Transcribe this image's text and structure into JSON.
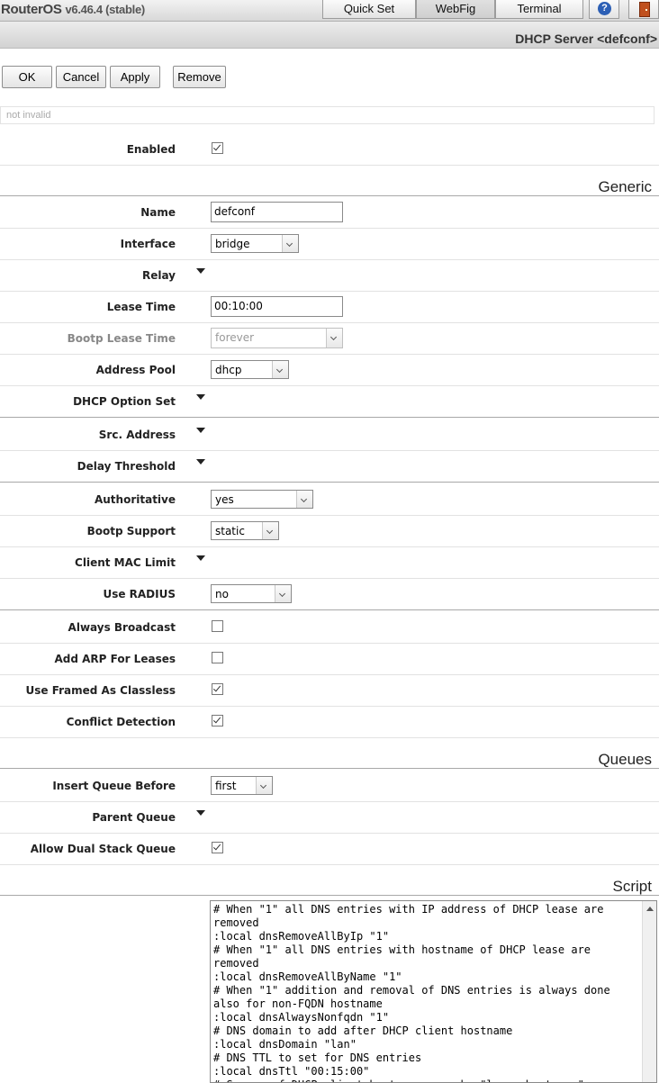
{
  "topbar": {
    "brand": "RouterOS",
    "version": "v6.46.4 (stable)",
    "tabs": [
      {
        "label": "Quick Set",
        "active": false
      },
      {
        "label": "WebFig",
        "active": true
      },
      {
        "label": "Terminal",
        "active": false
      }
    ],
    "help_icon": "question-icon",
    "logout_icon": "door-icon"
  },
  "title": "DHCP Server <defconf>",
  "actions": {
    "ok": "OK",
    "cancel": "Cancel",
    "apply": "Apply",
    "remove": "Remove"
  },
  "status": "not invalid",
  "fields": {
    "enabled": {
      "label": "Enabled",
      "checked": true
    },
    "name": {
      "label": "Name",
      "value": "defconf"
    },
    "interface": {
      "label": "Interface",
      "value": "bridge"
    },
    "relay": {
      "label": "Relay"
    },
    "lease_time": {
      "label": "Lease Time",
      "value": "00:10:00"
    },
    "bootp_lease_time": {
      "label": "Bootp Lease Time",
      "value": "forever"
    },
    "address_pool": {
      "label": "Address Pool",
      "value": "dhcp"
    },
    "dhcp_option_set": {
      "label": "DHCP Option Set"
    },
    "src_address": {
      "label": "Src. Address"
    },
    "delay_threshold": {
      "label": "Delay Threshold"
    },
    "authoritative": {
      "label": "Authoritative",
      "value": "yes"
    },
    "bootp_support": {
      "label": "Bootp Support",
      "value": "static"
    },
    "client_mac_limit": {
      "label": "Client MAC Limit"
    },
    "use_radius": {
      "label": "Use RADIUS",
      "value": "no"
    },
    "always_broadcast": {
      "label": "Always Broadcast",
      "checked": false
    },
    "add_arp": {
      "label": "Add ARP For Leases",
      "checked": false
    },
    "use_framed": {
      "label": "Use Framed As Classless",
      "checked": true
    },
    "conflict_detection": {
      "label": "Conflict Detection",
      "checked": true
    },
    "insert_queue_before": {
      "label": "Insert Queue Before",
      "value": "first"
    },
    "parent_queue": {
      "label": "Parent Queue"
    },
    "allow_dual_stack": {
      "label": "Allow Dual Stack Queue",
      "checked": true
    }
  },
  "sections": {
    "generic": "Generic",
    "queues": "Queues",
    "script": "Script"
  },
  "script_text": "# When \"1\" all DNS entries with IP address of DHCP lease are removed\n:local dnsRemoveAllByIp \"1\"\n# When \"1\" all DNS entries with hostname of DHCP lease are removed\n:local dnsRemoveAllByName \"1\"\n# When \"1\" addition and removal of DNS entries is always done also for non-FQDN hostname\n:local dnsAlwaysNonfqdn \"1\"\n# DNS domain to add after DHCP client hostname\n:local dnsDomain \"lan\"\n# DNS TTL to set for DNS entries\n:local dnsTtl \"00:15:00\"\n# Source of DHCP client hostname, can be \"lease-hostname\""
}
